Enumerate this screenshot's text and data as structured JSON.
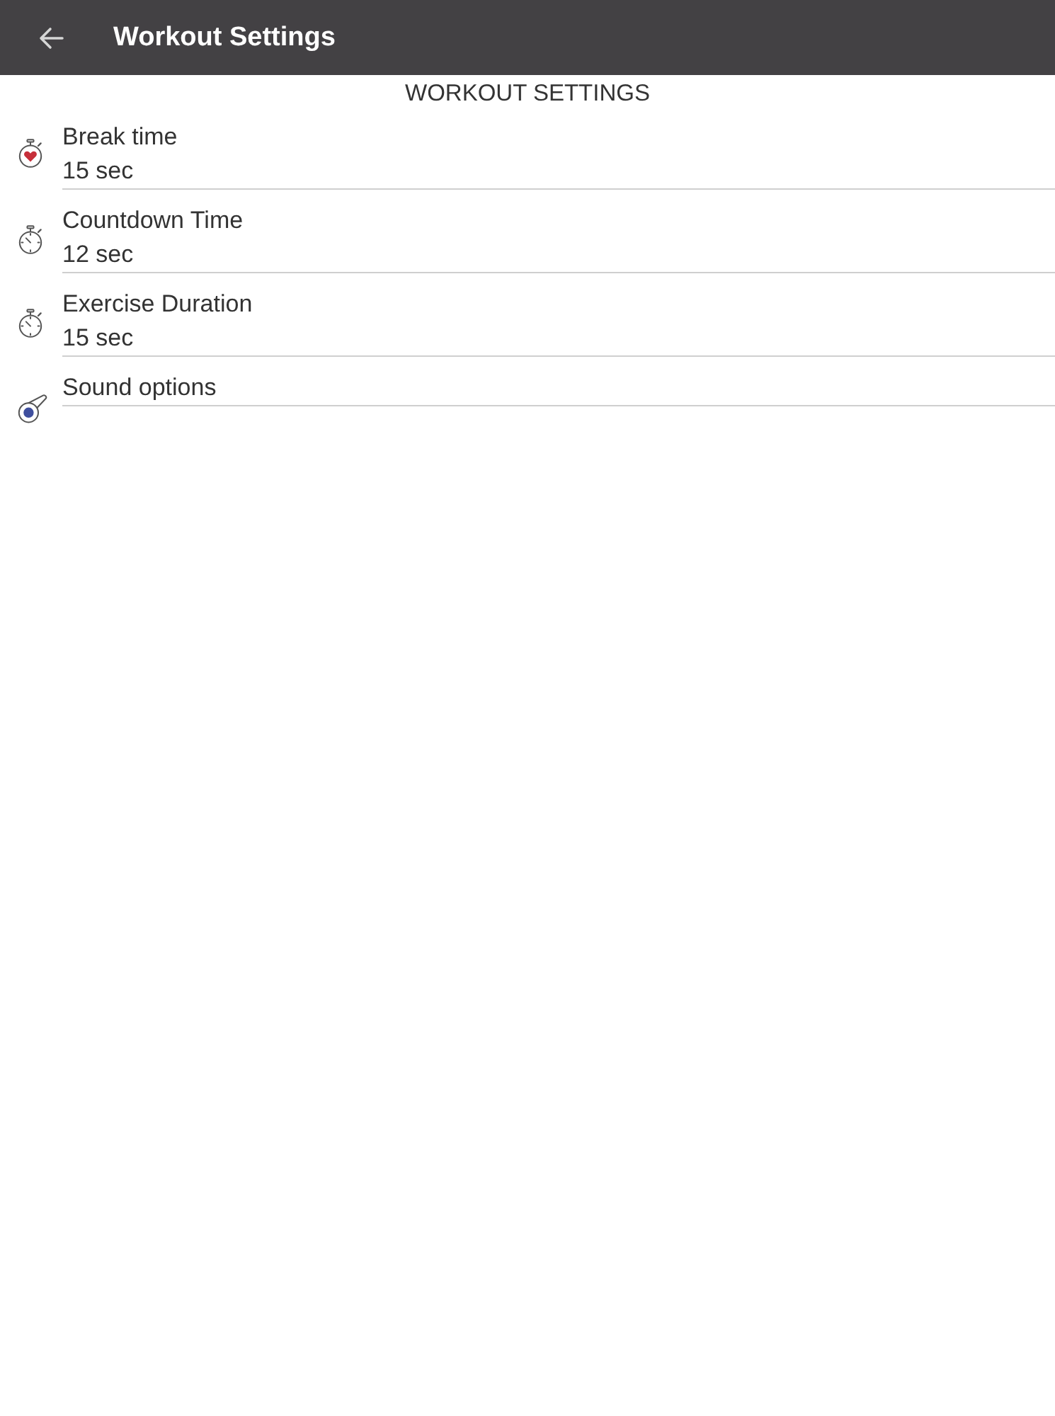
{
  "app_bar": {
    "title": "Workout Settings"
  },
  "section": {
    "heading": "WORKOUT SETTINGS"
  },
  "settings": [
    {
      "kind": "break",
      "label": "Break time",
      "value": "15 sec"
    },
    {
      "kind": "timer",
      "label": "Countdown Time",
      "value": "12 sec"
    },
    {
      "kind": "timer",
      "label": "Exercise Duration",
      "value": "15 sec"
    },
    {
      "kind": "sound",
      "label": "Sound options"
    }
  ]
}
